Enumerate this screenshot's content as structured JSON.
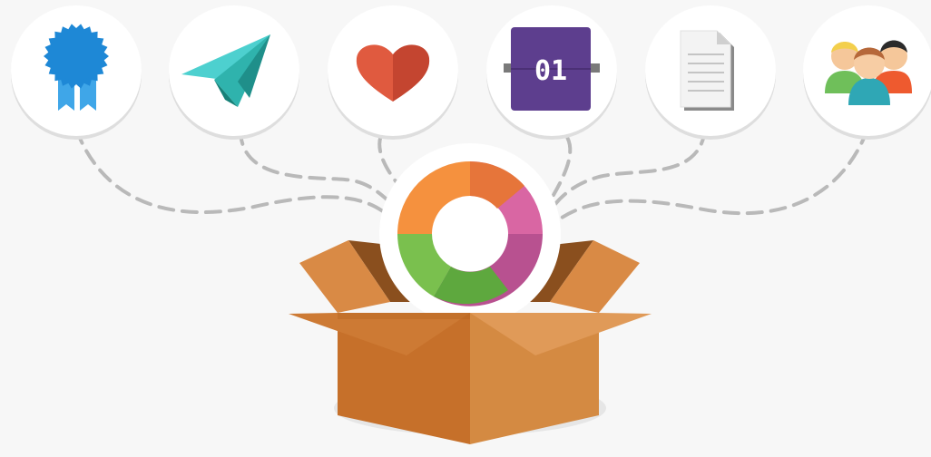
{
  "colors": {
    "background": "#f7f7f7",
    "circle": "#ffffff",
    "connector": "#b9b9b9",
    "box_front": "#c9762e",
    "box_side": "#d98a45",
    "logo_orange": "#f5913e",
    "logo_pink": "#d966a3",
    "logo_green": "#7ac04e"
  },
  "icons": [
    {
      "name": "ribbon-award-icon"
    },
    {
      "name": "paper-plane-icon"
    },
    {
      "name": "heart-icon"
    },
    {
      "name": "calendar-icon",
      "text": "01"
    },
    {
      "name": "document-icon"
    },
    {
      "name": "team-people-icon"
    }
  ],
  "center": {
    "logo": "play-logo-icon",
    "container": "open-box-icon"
  }
}
